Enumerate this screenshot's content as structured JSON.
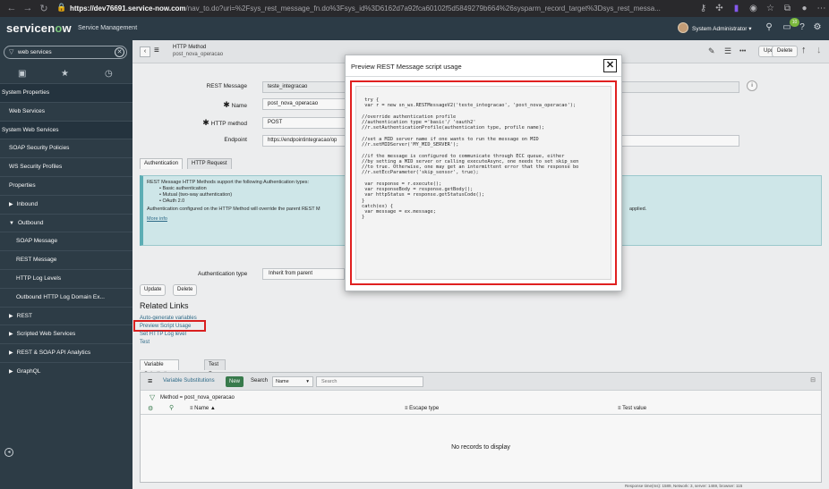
{
  "browser": {
    "url_host": "https://dev76691.service-now.com",
    "url_rest": "/nav_to.do?uri=%2Fsys_rest_message_fn.do%3Fsys_id%3D6162d7a92fca60102f5d5849279b664%26sysparm_record_target%3Dsys_rest_messa..."
  },
  "header": {
    "logo_pre": "servicen",
    "logo_o": "o",
    "logo_post": "w",
    "product": "Service Management",
    "user": "System Administrator",
    "chat_count": "10"
  },
  "sidebar": {
    "filter_value": "web services",
    "items": [
      {
        "label": "System Properties",
        "kind": "section"
      },
      {
        "label": "Web Services",
        "kind": "child0"
      },
      {
        "label": "System Web Services",
        "kind": "section"
      },
      {
        "label": "SOAP Security Policies",
        "kind": "child0"
      },
      {
        "label": "WS Security Profiles",
        "kind": "child0"
      },
      {
        "label": "Properties",
        "kind": "child0"
      },
      {
        "label": "Inbound",
        "kind": "group",
        "arrow": "▶"
      },
      {
        "label": "Outbound",
        "kind": "group",
        "arrow": "▼"
      },
      {
        "label": "SOAP Message",
        "kind": "child"
      },
      {
        "label": "REST Message",
        "kind": "child"
      },
      {
        "label": "HTTP Log Levels",
        "kind": "child"
      },
      {
        "label": "Outbound HTTP Log Domain Ex...",
        "kind": "child"
      },
      {
        "label": "REST",
        "kind": "group",
        "arrow": "▶"
      },
      {
        "label": "Scripted Web Services",
        "kind": "group",
        "arrow": "▶"
      },
      {
        "label": "REST & SOAP API Analytics",
        "kind": "group",
        "arrow": "▶"
      },
      {
        "label": "GraphQL",
        "kind": "group",
        "arrow": "▶"
      }
    ]
  },
  "form": {
    "type": "HTTP Method",
    "name": "post_nova_operacao",
    "update_label": "Update",
    "delete_label": "Delete",
    "fields": {
      "rest_message_label": "REST Message",
      "rest_message_value": "teste_integracao",
      "name_label": "Name",
      "name_value": "post_nova_operacao",
      "http_method_label": "HTTP method",
      "http_method_value": "POST",
      "endpoint_label": "Endpoint",
      "endpoint_value": "https://endpointintegracao/op"
    },
    "tabs": [
      "Authentication",
      "HTTP Request"
    ],
    "auth_info": {
      "line1": "REST Message HTTP Methods support the following Authentication types:",
      "bullets": [
        "Basic authentication",
        "Mutual (two-way authentication)",
        "OAuth 2.0"
      ],
      "line2": "Authentication configured on the HTTP Method will override the parent REST M",
      "line2_tail": "applied.",
      "more_info": "More info"
    },
    "auth_type_label": "Authentication type",
    "auth_type_value": "Inherit from parent",
    "buttons": [
      "Update",
      "Delete"
    ]
  },
  "related_links": {
    "title": "Related Links",
    "links": [
      "Auto-generate variables",
      "Preview Script Usage",
      "Set HTTP Log level",
      "Test"
    ]
  },
  "related_list": {
    "tabs": [
      "Variable Substitutions",
      "Test Runs"
    ],
    "title": "Variable Substitutions",
    "new_label": "New",
    "search_label": "Search",
    "search_field": "Name",
    "search_placeholder": "Search",
    "filter_text": "Method = post_nova_operacao",
    "columns": [
      "Name ▲",
      "Escape type",
      "Test value"
    ],
    "empty_text": "No records to display"
  },
  "footer": {
    "response_time": "Response time(ms): 1589, Network: 3, server: 1469, browser: 115"
  },
  "modal": {
    "title": "Preview REST Message script usage",
    "close": "✕",
    "code": " try {\n var r = new sn_ws.RESTMessageV2('teste_integracao', 'post_nova_operacao');\n\n//override authentication profile\n//authentication type ='basic'/ 'oauth2'\n//r.setAuthenticationProfile(authentication type, profile name);\n\n//set a MID server name if one wants to run the message on MID\n//r.setMIDServer('MY_MID_SERVER');\n\n//if the message is configured to communicate through ECC queue, either\n//by setting a MID server or calling executeAsync, one needs to set skip_sen\n//to true. Otherwise, one may get an intermittent error that the response bo\n//r.setEccParameter('skip_sensor', true);\n\n var response = r.execute();\n var responseBody = response.getBody();\n var httpStatus = response.getStatusCode();\n}\ncatch(ex) {\n var message = ex.message;\n}"
  }
}
